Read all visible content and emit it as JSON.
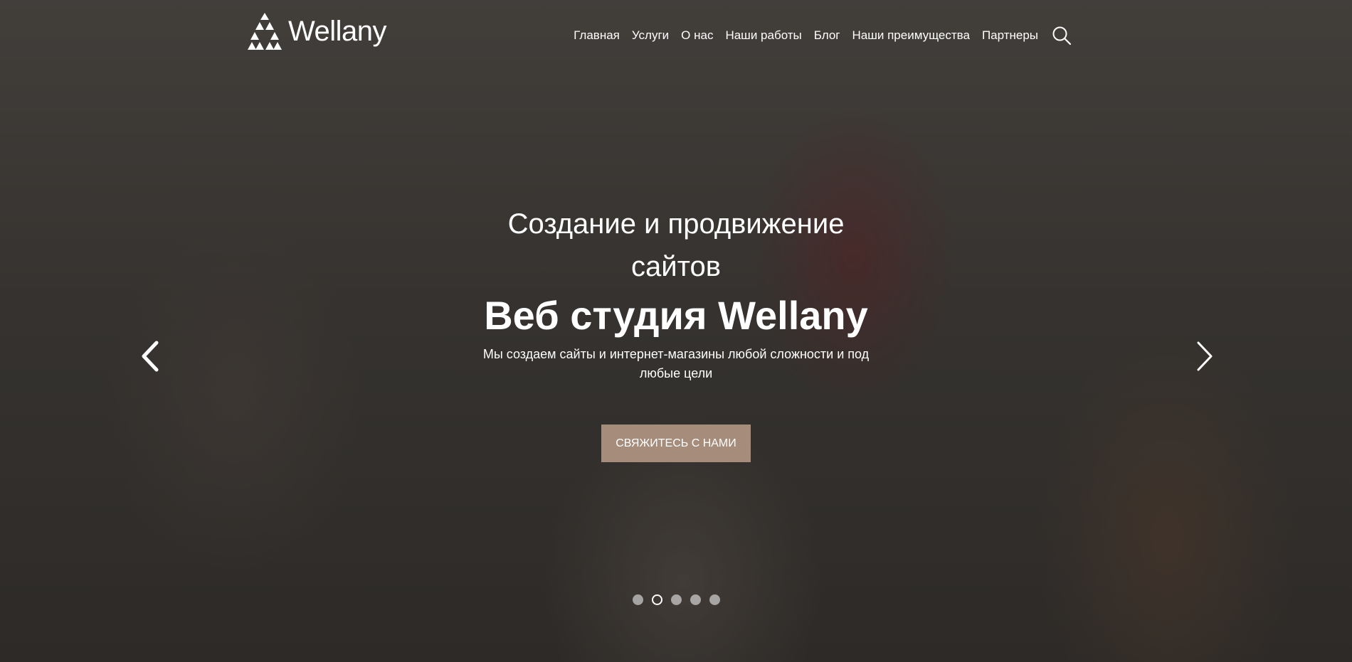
{
  "brand": {
    "name": "Wellany",
    "logo_icon": "triangle-logo-icon"
  },
  "nav": {
    "items": [
      {
        "label": "Главная"
      },
      {
        "label": "Услуги"
      },
      {
        "label": "О нас"
      },
      {
        "label": "Наши работы"
      },
      {
        "label": "Блог"
      },
      {
        "label": "Наши преимущества"
      },
      {
        "label": "Партнеры"
      }
    ],
    "search_icon": "search-icon"
  },
  "hero": {
    "subtitle": "Создание и продвижение сайтов",
    "title": "Веб студия Wellany",
    "description": "Мы создаем сайты и интернет-магазины любой сложности и под любые цели",
    "cta_label": "СВЯЖИТЕСЬ С НАМИ",
    "cta_color": "#a68c7b"
  },
  "slider": {
    "prev_icon": "chevron-left-icon",
    "next_icon": "chevron-right-icon",
    "slide_count": 5,
    "active_slide": 2
  }
}
